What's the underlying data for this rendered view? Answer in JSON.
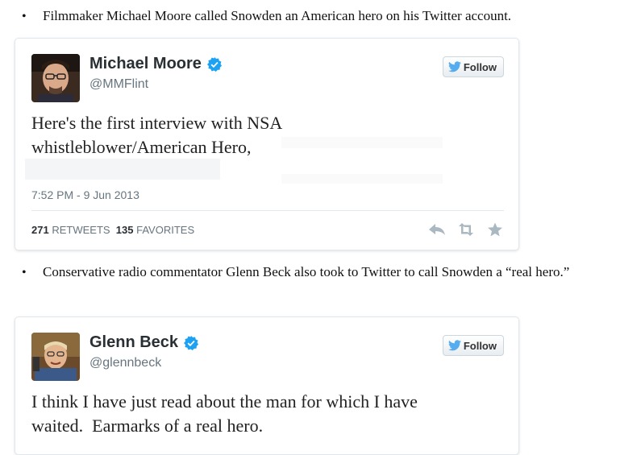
{
  "para1": {
    "text": "Filmmaker Michael Moore called Snowden an American hero on his Twitter account."
  },
  "tweet1": {
    "name": "Michael Moore",
    "handle": "@MMFlint",
    "follow_label": "Follow",
    "text_line1": "Here's the first interview with NSA",
    "text_line2": "whistleblower/American Hero,",
    "timestamp": "7:52 PM - 9 Jun 2013",
    "retweets_count": "271",
    "retweets_label": "RETWEETS",
    "favorites_count": "135",
    "favorites_label": "FAVORITES"
  },
  "para2": {
    "text": "Conservative radio commentator Glenn Beck also took to Twitter to call Snowden a “real hero.”"
  },
  "tweet2": {
    "name": "Glenn Beck",
    "handle": "@glennbeck",
    "follow_label": "Follow",
    "text_line1": "I think I have just read about the man for which I have",
    "text_line2": "waited.  Earmarks of a real hero."
  },
  "colors": {
    "twitter_blue": "#55acee",
    "verified_blue": "#1da1f2",
    "muted_text": "#66757f",
    "action_icon": "#aab8c2"
  },
  "icons": {
    "verified": "verified-badge-icon",
    "follow": "twitter-bird-icon",
    "reply": "reply-icon",
    "retweet": "retweet-icon",
    "favorite": "star-icon"
  }
}
